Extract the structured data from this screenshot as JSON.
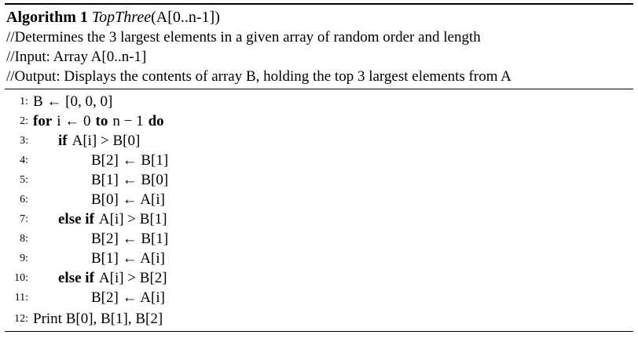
{
  "header": {
    "label": "Algorithm 1",
    "name": "TopThree",
    "args": "(A[0..n-1])"
  },
  "comments": [
    "//Determines the 3 largest elements in a given array of random order and length",
    "//Input: Array A[0..n-1]",
    "//Output: Displays the contents of array B, holding the top 3 largest elements from A"
  ],
  "lines": [
    {
      "num": "1:",
      "indent": 0,
      "text": "B ← [0, 0, 0]"
    },
    {
      "num": "2:",
      "indent": 0,
      "kw": "for",
      "text": "i ← 0",
      "kw2": "to",
      "text2": "n − 1",
      "kw3": "do"
    },
    {
      "num": "3:",
      "indent": 1,
      "kw": "if",
      "text": "A[i] > B[0]"
    },
    {
      "num": "4:",
      "indent": 2,
      "text": "B[2] ← B[1]"
    },
    {
      "num": "5:",
      "indent": 2,
      "text": "B[1] ← B[0]"
    },
    {
      "num": "6:",
      "indent": 2,
      "text": "B[0] ← A[i]"
    },
    {
      "num": "7:",
      "indent": 1,
      "kw": "else if",
      "text": "A[i] > B[1]"
    },
    {
      "num": "8:",
      "indent": 2,
      "text": "B[2] ← B[1]"
    },
    {
      "num": "9:",
      "indent": 2,
      "text": "B[1] ← A[i]"
    },
    {
      "num": "10:",
      "indent": 1,
      "kw": "else if",
      "text": "A[i] > B[2]"
    },
    {
      "num": "11:",
      "indent": 2,
      "text": "B[2] ← A[i]"
    },
    {
      "num": "12:",
      "indent": 0,
      "text": "Print B[0], B[1], B[2]"
    }
  ]
}
